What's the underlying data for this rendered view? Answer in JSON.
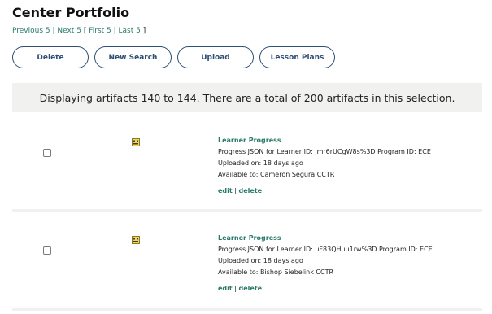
{
  "page": {
    "title": "Center Portfolio"
  },
  "pager": {
    "previous": "Previous 5",
    "next": "Next 5",
    "first": "First 5",
    "last": "Last 5"
  },
  "buttons": {
    "delete": "Delete",
    "new_search": "New Search",
    "upload": "Upload",
    "lesson_plans": "Lesson Plans"
  },
  "banner": "Displaying artifacts 140 to 144. There are a total of 200 artifacts in this selection.",
  "artifacts": [
    {
      "kind": "Learner Progress",
      "description": "Progress JSON for Learner ID: jmr6rUCgW8s%3D Program ID: ECE",
      "uploaded": "Uploaded on: 18 days ago",
      "available": "Available to: Cameron Segura CCTR",
      "edit": "edit",
      "delete": "delete",
      "checked": false
    },
    {
      "kind": "Learner Progress",
      "description": "Progress JSON for Learner ID: uF83QHuu1rw%3D Program ID: ECE",
      "uploaded": "Uploaded on: 18 days ago",
      "available": "Available to: Bishop Siebelink CCTR",
      "edit": "edit",
      "delete": "delete",
      "checked": false
    }
  ],
  "colors": {
    "link": "#2a7a6a",
    "button_border": "#2f4f73",
    "panel_bg": "#f1f1f0"
  }
}
